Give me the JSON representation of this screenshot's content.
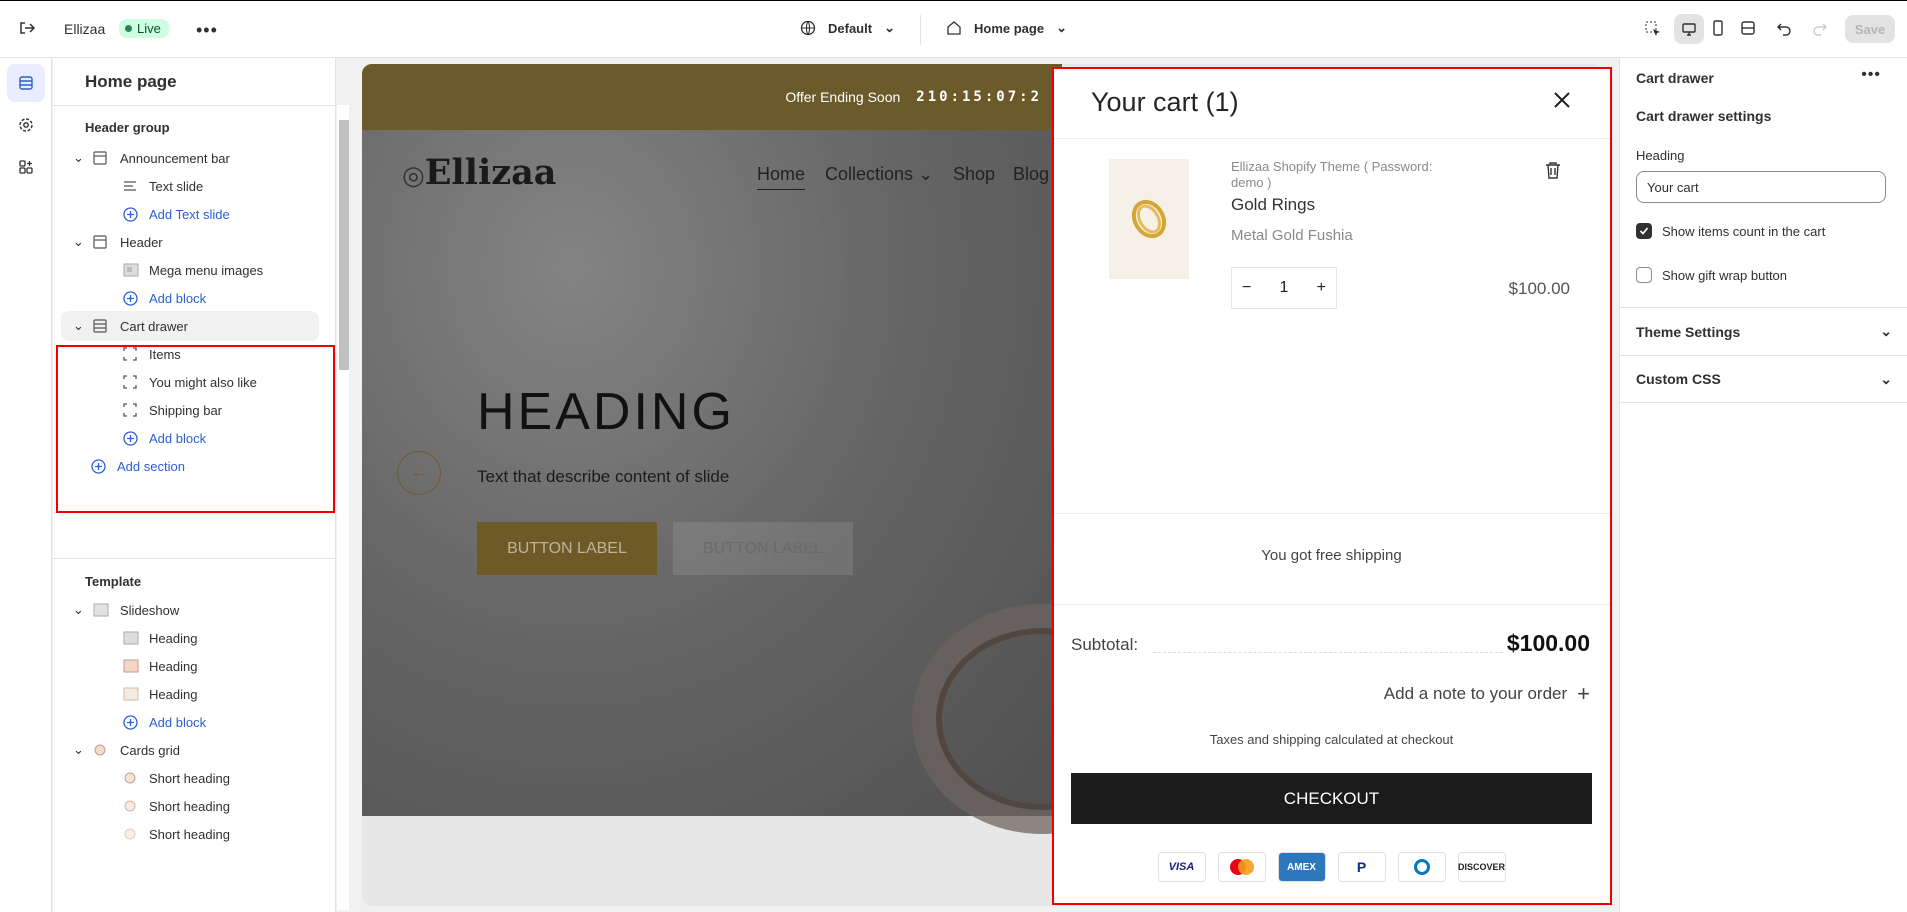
{
  "topbar": {
    "store_name": "Ellizaa",
    "status": "Live",
    "theme_select": "Default",
    "page_select": "Home page",
    "save_label": "Save"
  },
  "sidebar": {
    "title": "Home page",
    "header_group_label": "Header group",
    "template_label": "Template",
    "items": [
      {
        "label": "Announcement bar",
        "level": 1,
        "icon": "section-icon"
      },
      {
        "label": "Text slide",
        "level": 2,
        "icon": "text-icon"
      },
      {
        "label": "Add Text slide",
        "level": 2,
        "icon": "plus-circle-icon"
      },
      {
        "label": "Header",
        "level": 1,
        "icon": "section-icon"
      },
      {
        "label": "Mega menu images",
        "level": 2,
        "icon": "image-icon"
      },
      {
        "label": "Add block",
        "level": 2,
        "icon": "plus-circle-icon"
      },
      {
        "label": "Cart drawer",
        "level": 1,
        "icon": "section-icon"
      },
      {
        "label": "Items",
        "level": 2,
        "icon": "block-icon"
      },
      {
        "label": "You might also like",
        "level": 2,
        "icon": "block-icon"
      },
      {
        "label": "Shipping bar",
        "level": 2,
        "icon": "block-icon"
      },
      {
        "label": "Add block",
        "level": 2,
        "icon": "plus-circle-icon"
      },
      {
        "label": "Add section",
        "level": 0,
        "icon": "plus-circle-icon"
      },
      {
        "label": "Slideshow",
        "level": 1,
        "icon": "image-icon"
      },
      {
        "label": "Heading",
        "level": 2,
        "icon": "image-icon"
      },
      {
        "label": "Heading",
        "level": 2,
        "icon": "image-icon"
      },
      {
        "label": "Heading",
        "level": 2,
        "icon": "image-icon"
      },
      {
        "label": "Add block",
        "level": 2,
        "icon": "plus-circle-icon"
      },
      {
        "label": "Cards grid",
        "level": 1,
        "icon": "image-icon"
      },
      {
        "label": "Short heading",
        "level": 2,
        "icon": "image-icon"
      },
      {
        "label": "Short heading",
        "level": 2,
        "icon": "image-icon"
      },
      {
        "label": "Short heading",
        "level": 2,
        "icon": "image-icon"
      }
    ]
  },
  "preview": {
    "announcement_text": "Offer Ending Soon",
    "announcement_timer": "210:15:07:2",
    "logo_text": "Ellizaa",
    "nav": [
      "Home",
      "Collections",
      "Shop",
      "Blog"
    ],
    "hero_heading": "HEADING",
    "hero_subtext": "Text that describe content of slide",
    "button1": "BUTTON LABEL",
    "button2": "BUTTON LABEL"
  },
  "cart": {
    "title": "Your cart (1)",
    "product_vendor": "Ellizaa Shopify Theme ( Password: demo )",
    "product_title": "Gold Rings",
    "product_variant": "Metal Gold Fushia",
    "quantity": "1",
    "price": "$100.00",
    "free_shipping": "You got free shipping",
    "subtotal_label": "Subtotal:",
    "subtotal_value": "$100.00",
    "note_label": "Add a note to your order",
    "tax_note": "Taxes and shipping calculated at checkout",
    "checkout_label": "CHECKOUT",
    "payments": [
      "VISA",
      "Mastercard",
      "AMEX",
      "PayPal",
      "Diners",
      "DISCOVER"
    ]
  },
  "right_panel": {
    "title": "Cart drawer",
    "subtitle": "Cart drawer settings",
    "heading_label": "Heading",
    "heading_value": "Your cart",
    "show_count_label": "Show items count in the cart",
    "show_count_checked": true,
    "gift_wrap_label": "Show gift wrap button",
    "gift_wrap_checked": false,
    "theme_settings": "Theme Settings",
    "custom_css": "Custom CSS"
  },
  "colors": {
    "accent_link": "#2c5fcf",
    "selection_outline": "#e00000",
    "announcement_bg": "#6b5a2a",
    "checkout_bg": "#1b1b1b"
  }
}
